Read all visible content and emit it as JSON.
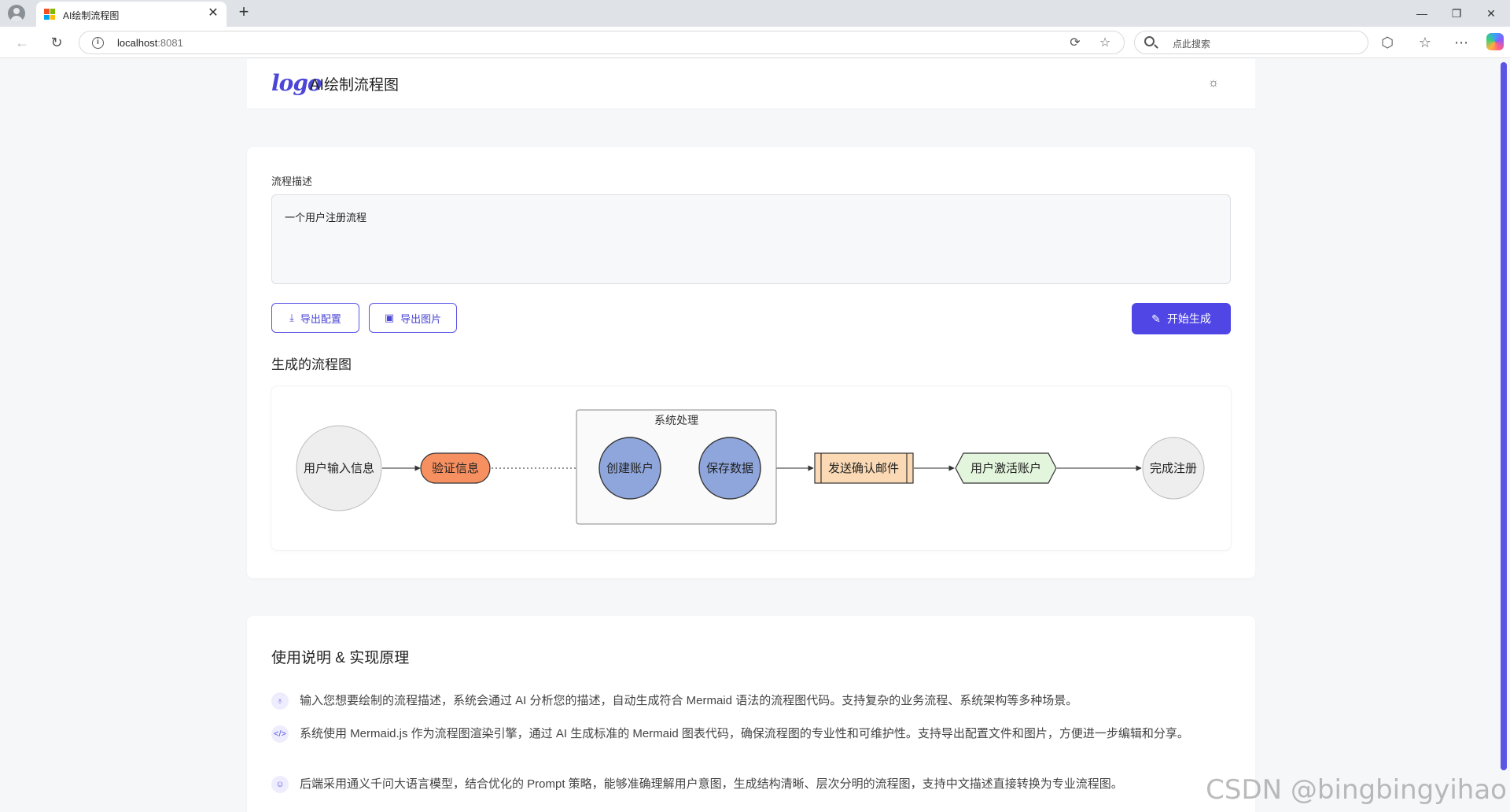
{
  "browser": {
    "tab_title": "AI绘制流程图",
    "url_host": "localhost",
    "url_port": ":8081",
    "search_placeholder": "点此搜索"
  },
  "header": {
    "logo_text": "logo",
    "title": "AI绘制流程图"
  },
  "form": {
    "label": "流程描述",
    "value": "一个用户注册流程",
    "export_config_label": "导出配置",
    "export_image_label": "导出图片",
    "generate_label": "开始生成"
  },
  "diagram": {
    "section_title": "生成的流程图",
    "subgraph_label": "系统处理",
    "nodes": {
      "input": "用户输入信息",
      "verify": "验证信息",
      "create": "创建账户",
      "save": "保存数据",
      "email": "发送确认邮件",
      "activate": "用户激活账户",
      "done": "完成注册"
    },
    "colors": {
      "circle_fill": "#eeeeee",
      "verify_fill": "#f79060",
      "system_node_fill": "#8fa6dd",
      "email_fill": "#fbd9b4",
      "activate_fill": "#e3f5dd",
      "accent": "#4f46e5"
    }
  },
  "usage": {
    "title": "使用说明 & 实现原理",
    "items": [
      {
        "icon": "lightbulb-icon",
        "text": "输入您想要绘制的流程描述，系统会通过 AI 分析您的描述，自动生成符合 Mermaid 语法的流程图代码。支持复杂的业务流程、系统架构等多种场景。"
      },
      {
        "icon": "code-icon",
        "text": "系统使用 Mermaid.js 作为流程图渲染引擎，通过 AI 生成标准的 Mermaid 图表代码，确保流程图的专业性和可维护性。支持导出配置文件和图片，方便进一步编辑和分享。"
      },
      {
        "icon": "robot-icon",
        "text": "后端采用通义千问大语言模型，结合优化的 Prompt 策略，能够准确理解用户意图，生成结构清晰、层次分明的流程图，支持中文描述直接转换为专业流程图。"
      }
    ]
  },
  "watermark": "CSDN @bingbingyihao"
}
